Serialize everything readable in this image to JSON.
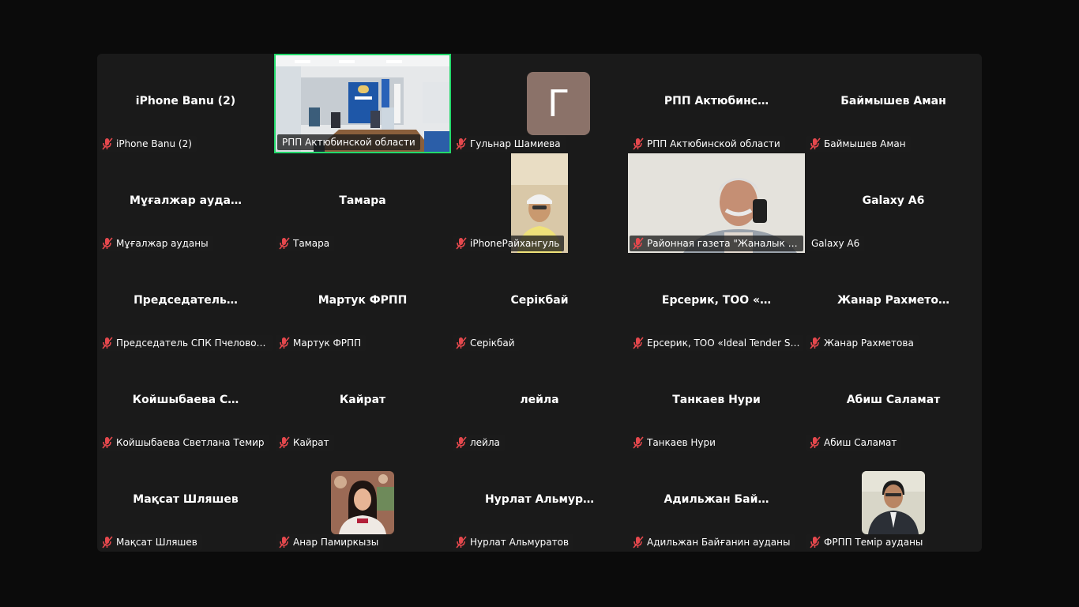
{
  "participants": [
    {
      "display": "iPhone Banu (2)",
      "label": "iPhone Banu (2)"
    },
    {
      "display": "",
      "label": "РПП Актюбинской области"
    },
    {
      "display": "",
      "label": "Гульнар Шамиева",
      "avatar_letter": "Г"
    },
    {
      "display": "РПП  Актюбинс…",
      "label": "РПП Актюбинской области"
    },
    {
      "display": "Баймышев Аман",
      "label": "Баймышев Аман"
    },
    {
      "display": "Мұғалжар  ауда…",
      "label": "Мұғалжар ауданы"
    },
    {
      "display": "Тамара",
      "label": "Тамара"
    },
    {
      "display": "",
      "label": "iPhoneРайхангуль"
    },
    {
      "display": "",
      "label": "Районная газета \"Жаналык жар…"
    },
    {
      "display": "Galaxy A6",
      "label": "Galaxy A6"
    },
    {
      "display": "Председатель…",
      "label": "Председатель СПК Пчеловоды…"
    },
    {
      "display": "Мартук ФРПП",
      "label": "Мартук ФРПП"
    },
    {
      "display": "Серікбай",
      "label": "Серікбай"
    },
    {
      "display": "Ерсерик,  ТОО  «…",
      "label": "Ерсерик, ТОО «Ideal Tender Ser…"
    },
    {
      "display": "Жанар  Рахмето…",
      "label": "Жанар Рахметова"
    },
    {
      "display": "Койшыбаева  С…",
      "label": "Койшыбаева Светлана Темир"
    },
    {
      "display": "Кайрат",
      "label": "Кайрат"
    },
    {
      "display": "лейла",
      "label": "лейла"
    },
    {
      "display": "Танкаев Нури",
      "label": "Танкаев Нури"
    },
    {
      "display": "Абиш Саламат",
      "label": "Абиш Саламат"
    },
    {
      "display": "Мақсат Шляшев",
      "label": "Мақсат Шляшев"
    },
    {
      "display": "",
      "label": "Анар Памиркызы"
    },
    {
      "display": "Нурлат  Альмур…",
      "label": "Нурлат Альмуратов"
    },
    {
      "display": "Адильжан   Бай…",
      "label": "Адильжан  Байғанин ауданы"
    },
    {
      "display": "",
      "label": "ФРПП Темір ауданы"
    }
  ],
  "colors": {
    "active_speaker_border": "#23d96b",
    "muted_mic": "#e5484d",
    "tile_bg": "#1a1a1a",
    "avatar_bg": "#8b7269"
  },
  "icons": {
    "muted": "muted-microphone-icon"
  }
}
